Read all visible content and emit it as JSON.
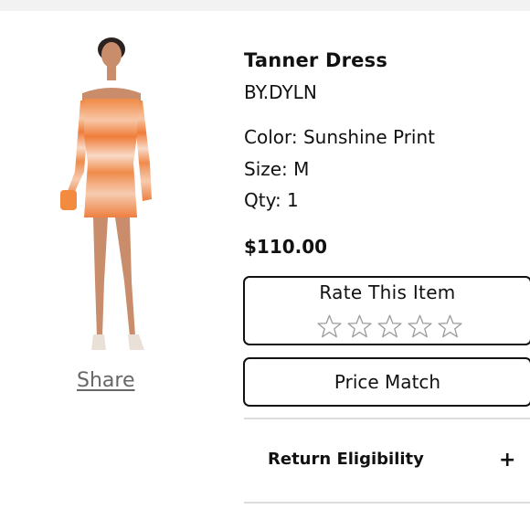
{
  "product": {
    "name": "Tanner Dress",
    "brand": "BY.DYLN",
    "color_line": "Color: Sunshine Print",
    "size_line": "Size: M",
    "qty_line": "Qty: 1",
    "price": "$110.00"
  },
  "share_label": "Share",
  "rating": {
    "title": "Rate This Item",
    "max_stars": 5,
    "selected": 0
  },
  "price_match_label": "Price Match",
  "return_section": {
    "label": "Return Eligibility",
    "toggle_symbol": "+"
  }
}
